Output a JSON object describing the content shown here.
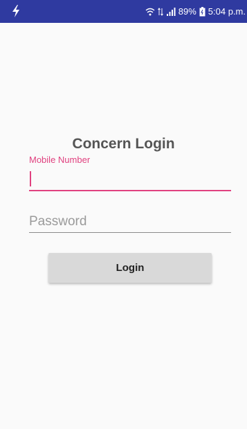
{
  "status_bar": {
    "battery_percent": "89%",
    "time": "5:04 p.m."
  },
  "login": {
    "title": "Concern Login",
    "mobile_label": "Mobile Number",
    "mobile_value": "",
    "password_placeholder": "Password",
    "password_value": "",
    "button_label": "Login"
  },
  "colors": {
    "status_bar_bg": "#2f3aa0",
    "accent": "#e0417f",
    "button_bg": "#d9d9d9"
  },
  "icons": {
    "status_left": "flash-icon",
    "wifi": "wifi-icon",
    "signal": "signal-icon",
    "battery": "battery-icon"
  }
}
